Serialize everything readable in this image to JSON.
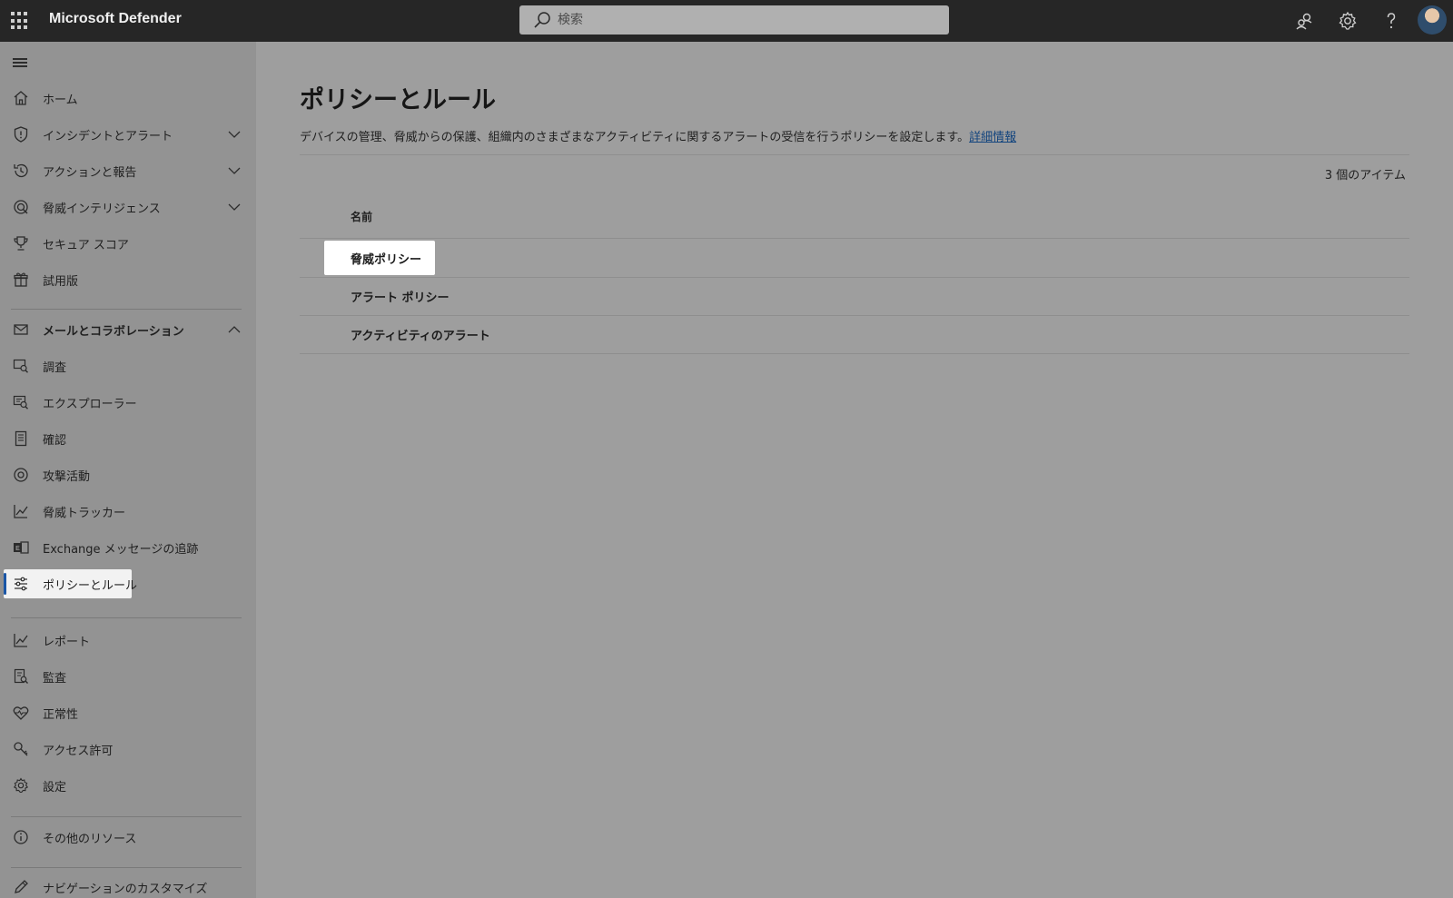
{
  "app": {
    "title": "Microsoft Defender"
  },
  "search": {
    "placeholder": "検索"
  },
  "topbar": {
    "icons": [
      "community-icon",
      "gear-icon",
      "help-icon",
      "avatar"
    ]
  },
  "sidebar": {
    "items": [
      {
        "label": "ホーム",
        "icon": "home-icon"
      },
      {
        "label": "インシデントとアラート",
        "icon": "shield-icon",
        "chevron": "down"
      },
      {
        "label": "アクションと報告",
        "icon": "history-icon",
        "chevron": "down"
      },
      {
        "label": "脅威インテリジェンス",
        "icon": "threat-intel-icon",
        "chevron": "down"
      },
      {
        "label": "セキュア スコア",
        "icon": "trophy-icon"
      },
      {
        "label": "試用版",
        "icon": "gift-icon"
      },
      {
        "label": "メールとコラボレーション",
        "icon": "mail-icon",
        "chevron": "up",
        "bold": true
      },
      {
        "label": "調査",
        "icon": "investigation-icon"
      },
      {
        "label": "エクスプローラー",
        "icon": "explorer-icon"
      },
      {
        "label": "確認",
        "icon": "review-icon"
      },
      {
        "label": "攻撃活動",
        "icon": "target-icon"
      },
      {
        "label": "脅威トラッカー",
        "icon": "chart-line-icon"
      },
      {
        "label": "Exchange メッセージの追跡",
        "icon": "exchange-icon"
      },
      {
        "label": "ポリシーとルール",
        "icon": "sliders-icon",
        "active": true
      },
      {
        "label": "レポート",
        "icon": "report-chart-icon"
      },
      {
        "label": "監査",
        "icon": "audit-icon"
      },
      {
        "label": "正常性",
        "icon": "heart-pulse-icon"
      },
      {
        "label": "アクセス許可",
        "icon": "key-icon"
      },
      {
        "label": "設定",
        "icon": "settings-icon"
      },
      {
        "label": "その他のリソース",
        "icon": "info-icon"
      },
      {
        "label": "ナビゲーションのカスタマイズ",
        "icon": "pencil-icon"
      }
    ]
  },
  "main": {
    "title": "ポリシーとルール",
    "description": "デバイスの管理、脅威からの保護、組織内のさまざまなアクティビティに関するアラートの受信を行うポリシーを設定します。",
    "learn_more": "詳細情報",
    "item_count": "3 個のアイテム",
    "column_name": "名前",
    "rows": [
      {
        "label": "脅威ポリシー",
        "selected": true
      },
      {
        "label": "アラート ポリシー"
      },
      {
        "label": "アクティビティのアラート"
      }
    ]
  },
  "colors": {
    "topbar": "#262626",
    "sidebar": "#939393",
    "main_bg": "#9e9e9e",
    "accent": "#1a56a6",
    "link": "#12447e"
  }
}
